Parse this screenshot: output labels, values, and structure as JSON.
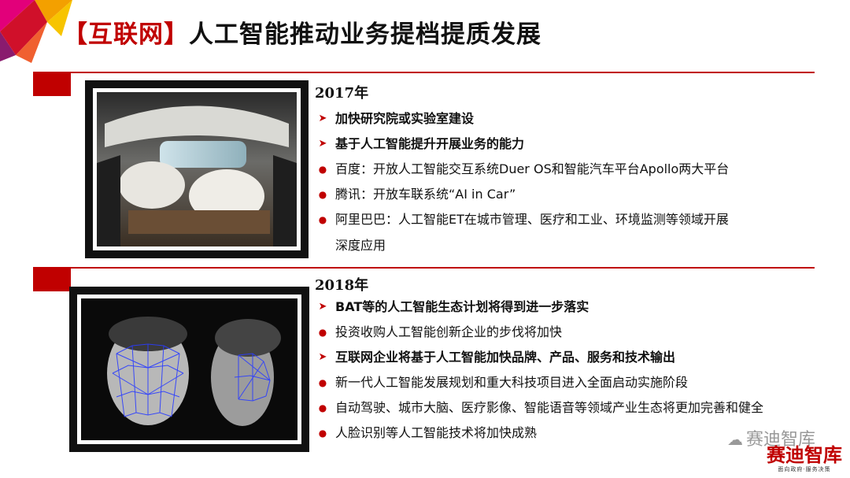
{
  "title": {
    "tag": "【互联网】",
    "text": "人工智能推动业务提档提质发展"
  },
  "sections": [
    {
      "year": "2017年",
      "items": [
        {
          "marker": "arrow",
          "bold": true,
          "text": "加快研究院或实验室建设"
        },
        {
          "marker": "arrow",
          "bold": true,
          "text": "基于人工智能提升开展业务的能力"
        },
        {
          "marker": "dot",
          "bold": false,
          "text": "百度：开放人工智能交互系统Duer OS和智能汽车平台Apollo两大平台"
        },
        {
          "marker": "dot",
          "bold": false,
          "text": "腾讯：开放车联系统“AI in Car”"
        },
        {
          "marker": "dot",
          "bold": false,
          "text": "阿里巴巴：人工智能ET在城市管理、医疗和工业、环境监测等领域开展",
          "cont": "深度应用"
        }
      ]
    },
    {
      "year": "2018年",
      "items": [
        {
          "marker": "arrow",
          "bold": true,
          "text": "BAT等的人工智能生态计划将得到进一步落实"
        },
        {
          "marker": "dot",
          "bold": false,
          "text": "投资收购人工智能创新企业的步伐将加快"
        },
        {
          "marker": "arrow",
          "bold": true,
          "text": "互联网企业将基于人工智能加快品牌、产品、服务和技术输出"
        },
        {
          "marker": "dot",
          "bold": false,
          "text": "新一代人工智能发展规划和重大科技项目进入全面启动实施阶段"
        },
        {
          "marker": "dot",
          "bold": false,
          "text": "自动驾驶、城市大脑、医疗影像、智能语音等领域产业生态将更加完善和健全"
        },
        {
          "marker": "dot",
          "bold": false,
          "text": "人脸识别等人工智能技术将加快成熟"
        }
      ]
    }
  ],
  "watermark": {
    "text": "赛迪智库"
  },
  "logo": {
    "name": "赛迪智库",
    "slogan": "面向政府·服务决策"
  },
  "colors": {
    "accent": "#c00000"
  },
  "icons": {
    "arrow": "right-arrow-icon",
    "dot": "bullet-dot-icon",
    "watermark": "wechat-icon"
  }
}
